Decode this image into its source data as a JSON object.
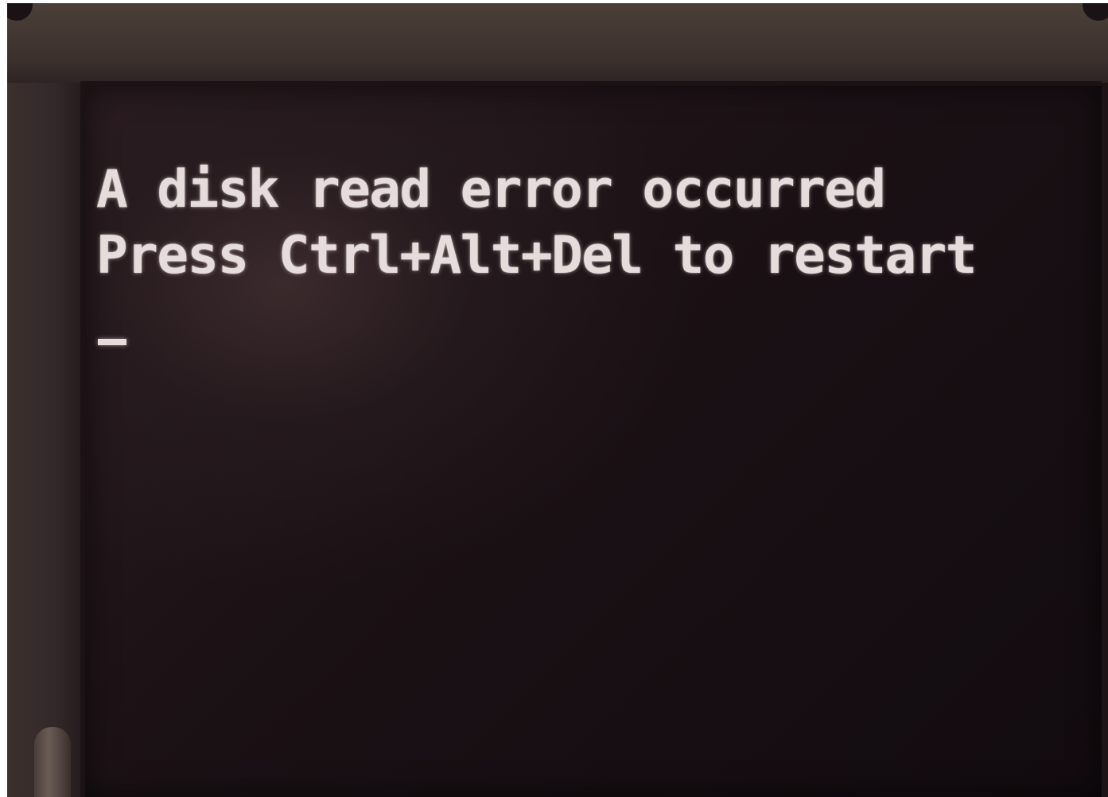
{
  "terminal": {
    "lines": [
      "A disk read error occurred",
      "Press Ctrl+Alt+Del to restart"
    ]
  },
  "colors": {
    "text": "#e6dcdc",
    "screen_background": "#1a1115",
    "bezel": "#3a2f2c"
  }
}
